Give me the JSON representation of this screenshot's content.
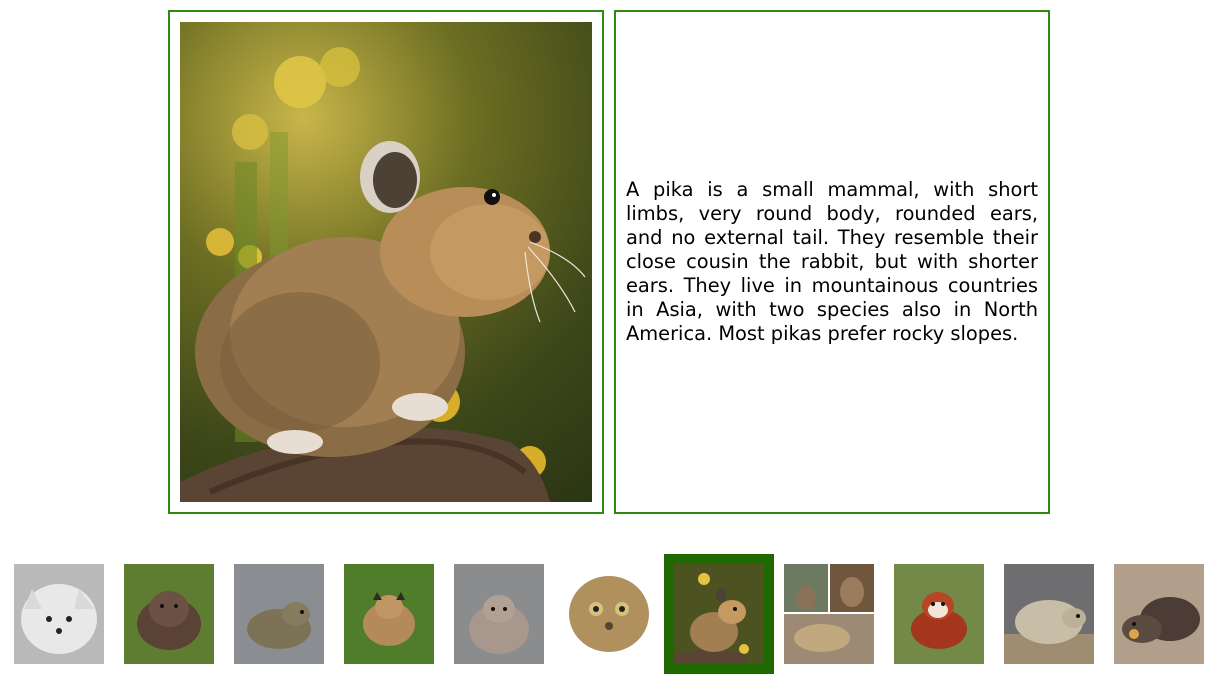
{
  "main": {
    "animal_name": "pika",
    "description": "A pika is a small mammal, with short limbs, very round body, rounded ears, and no external tail. They resemble their close cousin the rabbit, but with shorter ears. They live in mountainous countries in Asia, with two species also in North America. Most pikas prefer rocky slopes."
  },
  "thumbnails": [
    {
      "animal": "arctic fox",
      "selected": false
    },
    {
      "animal": "wombat",
      "selected": false
    },
    {
      "animal": "rodent",
      "selected": false
    },
    {
      "animal": "lynx",
      "selected": false
    },
    {
      "animal": "pallas cat",
      "selected": false
    },
    {
      "animal": "pallas cat face",
      "selected": false
    },
    {
      "animal": "pika",
      "selected": true
    },
    {
      "animal": "quokka",
      "selected": false
    },
    {
      "animal": "red panda",
      "selected": false
    },
    {
      "animal": "wombat",
      "selected": false
    },
    {
      "animal": "wombat",
      "selected": false
    }
  ],
  "colors": {
    "frame_border": "#2f8a0f",
    "selected_border": "#1f6a00"
  }
}
